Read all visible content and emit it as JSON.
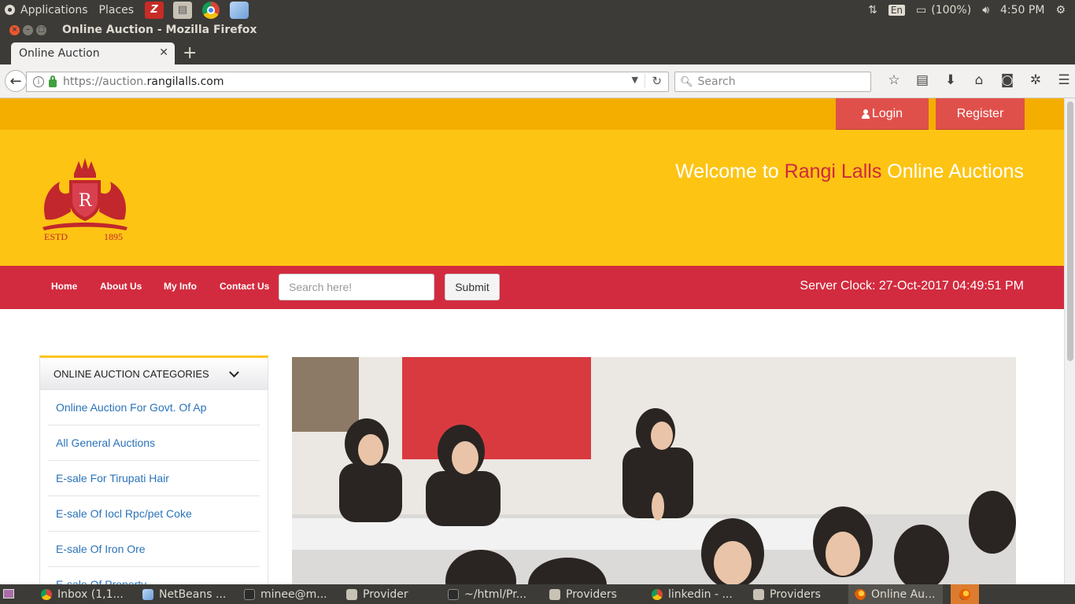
{
  "system_panel": {
    "applications": "Applications",
    "places": "Places",
    "lang": "En",
    "battery": "(100%)",
    "time": "4:50 PM"
  },
  "window": {
    "title": "Online Auction - Mozilla Firefox"
  },
  "tabs": [
    {
      "label": "Online Auction"
    }
  ],
  "navbar": {
    "url_prefix": "https://auction.",
    "url_domain": "rangilalls.com",
    "search_placeholder": "Search"
  },
  "site": {
    "login_label": "Login",
    "register_label": "Register",
    "welcome_pre": "Welcome to ",
    "welcome_brand": "Rangi Lalls",
    "welcome_post": " Online Auctions",
    "logo_estd": "ESTD",
    "logo_year": "1895",
    "logo_monogram": "R",
    "nav": [
      {
        "label": "Home"
      },
      {
        "label": "About Us"
      },
      {
        "label": "My Info"
      },
      {
        "label": "Contact Us"
      }
    ],
    "search_placeholder": "Search here!",
    "submit_label": "Submit",
    "server_clock": "Server Clock: 27-Oct-2017 04:49:51 PM",
    "categories_title": "ONLINE AUCTION CATEGORIES",
    "categories": [
      {
        "label": "Online Auction For Govt. Of Ap"
      },
      {
        "label": "All General Auctions"
      },
      {
        "label": "E-sale For Tirupati Hair"
      },
      {
        "label": "E-sale Of Iocl Rpc/pet Coke"
      },
      {
        "label": "E-sale Of Iron Ore"
      },
      {
        "label": "E-sale Of Property"
      }
    ]
  },
  "taskbar": [
    {
      "label": "Inbox (1,1...",
      "icon": "chrome-icon"
    },
    {
      "label": "NetBeans ...",
      "icon": "netbeans-icon"
    },
    {
      "label": "minee@m...",
      "icon": "terminal-icon"
    },
    {
      "label": "Provider",
      "icon": "files-icon"
    },
    {
      "label": "~/html/Pr...",
      "icon": "terminal-icon"
    },
    {
      "label": "Providers",
      "icon": "files-icon"
    },
    {
      "label": "linkedin - ...",
      "icon": "chrome-icon"
    },
    {
      "label": "Providers",
      "icon": "files-icon"
    },
    {
      "label": "Online Au...",
      "icon": "firefox-icon"
    }
  ],
  "colors": {
    "header_yellow": "#fdc413",
    "top_strip": "#f4ae00",
    "nav_red": "#d22b3f",
    "button_red": "#e0504b",
    "link_blue": "#2a73b9"
  }
}
